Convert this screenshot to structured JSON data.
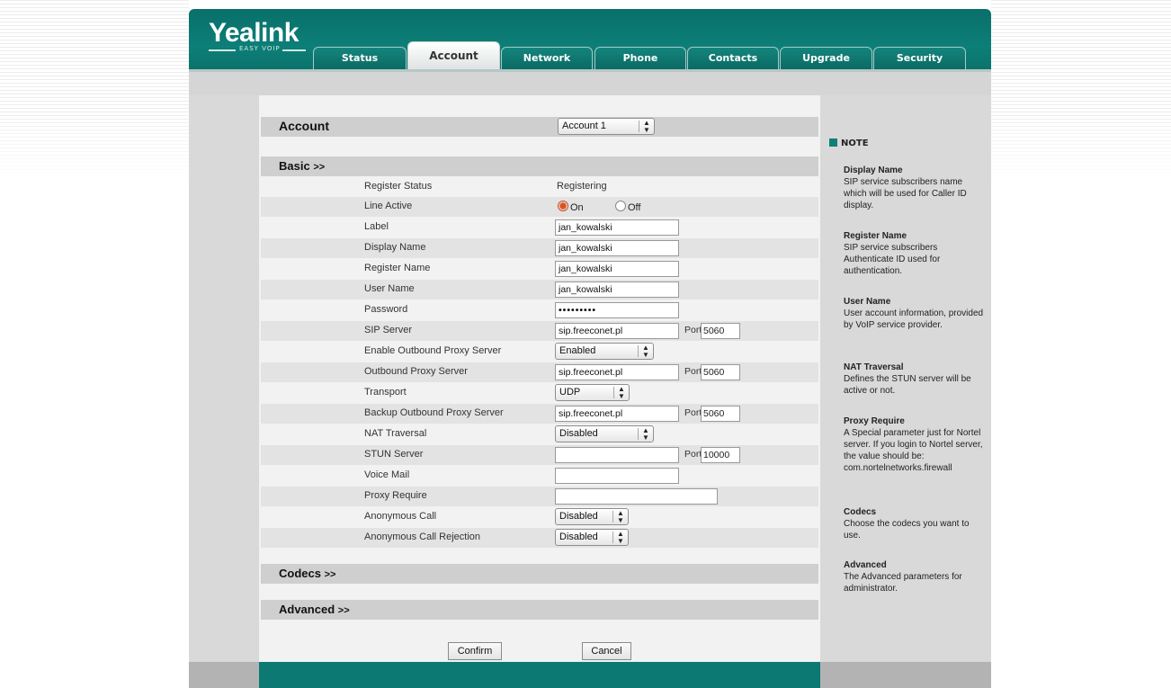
{
  "brand": {
    "name": "Yealink",
    "tagline": "EASY VOIP"
  },
  "tabs": [
    {
      "label": "Status",
      "active": false
    },
    {
      "label": "Account",
      "active": true
    },
    {
      "label": "Network",
      "active": false
    },
    {
      "label": "Phone",
      "active": false
    },
    {
      "label": "Contacts",
      "active": false
    },
    {
      "label": "Upgrade",
      "active": false
    },
    {
      "label": "Security",
      "active": false
    }
  ],
  "account": {
    "title": "Account",
    "selected": "Account 1"
  },
  "sections": {
    "basic": "Basic",
    "codecs": "Codecs",
    "advanced": "Advanced",
    "expand": ">>"
  },
  "basic": {
    "register_status_label": "Register Status",
    "register_status_value": "Registering",
    "line_active_label": "Line Active",
    "line_active_on": "On",
    "line_active_off": "Off",
    "label_label": "Label",
    "label_value": "jan_kowalski",
    "display_name_label": "Display Name",
    "display_name_value": "jan_kowalski",
    "register_name_label": "Register Name",
    "register_name_value": "jan_kowalski",
    "user_name_label": "User Name",
    "user_name_value": "jan_kowalski",
    "password_label": "Password",
    "password_value": "•••••••••",
    "sip_server_label": "SIP Server",
    "sip_server_value": "sip.freeconet.pl",
    "sip_server_port": "5060",
    "port_label": "Port",
    "enable_outbound_label": "Enable Outbound Proxy Server",
    "enable_outbound_value": "Enabled",
    "outbound_label": "Outbound Proxy Server",
    "outbound_value": "sip.freeconet.pl",
    "outbound_port": "5060",
    "transport_label": "Transport",
    "transport_value": "UDP",
    "backup_outbound_label": "Backup Outbound Proxy Server",
    "backup_outbound_value": "sip.freeconet.pl",
    "backup_outbound_port": "5060",
    "nat_label": "NAT Traversal",
    "nat_value": "Disabled",
    "stun_label": "STUN Server",
    "stun_value": "",
    "stun_port": "10000",
    "voicemail_label": "Voice Mail",
    "voicemail_value": "",
    "proxy_require_label": "Proxy Require",
    "proxy_require_value": "",
    "anon_call_label": "Anonymous Call",
    "anon_call_value": "Disabled",
    "anon_reject_label": "Anonymous Call Rejection",
    "anon_reject_value": "Disabled"
  },
  "buttons": {
    "confirm": "Confirm",
    "cancel": "Cancel"
  },
  "note": {
    "title": "NOTE",
    "items": [
      {
        "heading": "Display Name",
        "text": "SIP service subscribers name which will be used for Caller ID display."
      },
      {
        "heading": "Register Name",
        "text": "SIP service subscribers Authenticate ID used for authentication."
      },
      {
        "heading": "User Name",
        "text": "User account information, provided by VoIP service provider."
      },
      {
        "heading": "NAT Traversal",
        "text": "Defines the STUN server will be active or not."
      },
      {
        "heading": "Proxy Require",
        "text": "A Special parameter just for Nortel server. If you login to Nortel server, the value should be: com.nortelnetworks.firewall"
      },
      {
        "heading": "Codecs",
        "text": "Choose the codecs you want to use."
      },
      {
        "heading": "Advanced",
        "text": "The Advanced parameters for administrator."
      }
    ]
  }
}
